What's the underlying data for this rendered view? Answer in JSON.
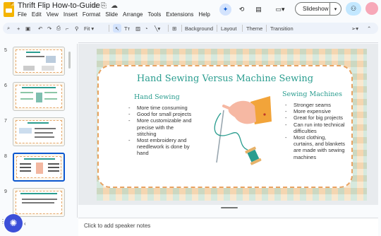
{
  "app": {
    "title": "Thrift Flip How-to-Guide",
    "menu": [
      "File",
      "Edit",
      "View",
      "Insert",
      "Format",
      "Slide",
      "Arrange",
      "Tools",
      "Extensions",
      "Help"
    ],
    "slideshow_label": "Slideshow"
  },
  "toolbar": {
    "zoom": "Fit",
    "background_label": "Background",
    "layout_label": "Layout",
    "theme_label": "Theme",
    "transition_label": "Transition"
  },
  "filmstrip": {
    "slides": [
      {
        "number": "5"
      },
      {
        "number": "6"
      },
      {
        "number": "7"
      },
      {
        "number": "8",
        "selected": true
      },
      {
        "number": "9"
      }
    ]
  },
  "slide": {
    "title": "Hand Sewing Versus Machine Sewing",
    "left_heading": "Hand Sewing",
    "left_items": [
      "More time consuming",
      "Good for small projects",
      "More customizable and precise with the stitching",
      "Most embroidery and needlework  is done by hand"
    ],
    "right_heading": "Sewing Machines",
    "right_items": [
      "Stronger seams",
      "More expensive",
      "Great for big projects",
      "Can run into technical difficulties",
      "Most clothing, curtains, and blankets are made with sewing machines"
    ]
  },
  "notes": {
    "placeholder": "Click to add speaker notes"
  },
  "colors": {
    "accent": "#2a9d8f",
    "border": "#e9a362",
    "selection": "#0b57d0"
  }
}
